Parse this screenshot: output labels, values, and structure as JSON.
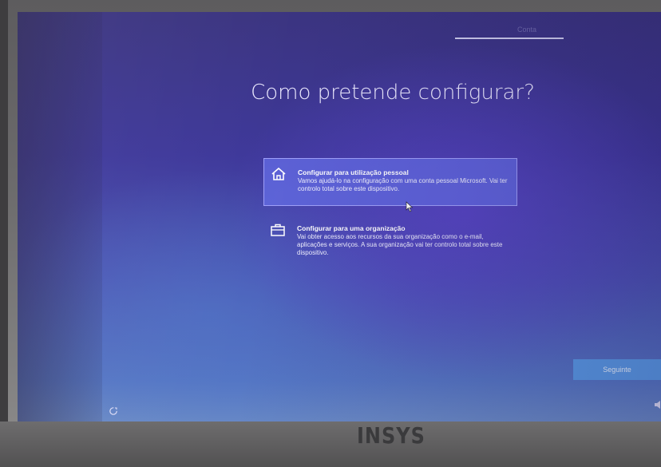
{
  "progress": {
    "step_label": "Conta"
  },
  "setup": {
    "title": "Como pretende configurar?",
    "options": [
      {
        "title": "Configurar para utilização pessoal",
        "description": "Vamos ajudá-lo na configuração com uma conta pessoal Microsoft. Vai ter controlo total sobre este dispositivo.",
        "icon": "home-icon",
        "selected": true
      },
      {
        "title": "Configurar para uma organização",
        "description": "Vai obter acesso aos recursos da sua organização como o e-mail, aplicações e serviços. A sua organização vai ter controlo total sobre este dispositivo.",
        "icon": "briefcase-icon",
        "selected": false
      }
    ],
    "next_label": "Seguinte"
  },
  "footer": {
    "ease_of_access_icon": "ease-of-access-icon",
    "volume_icon": "volume-icon"
  },
  "device": {
    "brand": "INSYS"
  },
  "colors": {
    "selected_option_bg": "#646ee6",
    "next_button_bg": "#5a9ae6",
    "screen_bg": "#3e389a"
  }
}
